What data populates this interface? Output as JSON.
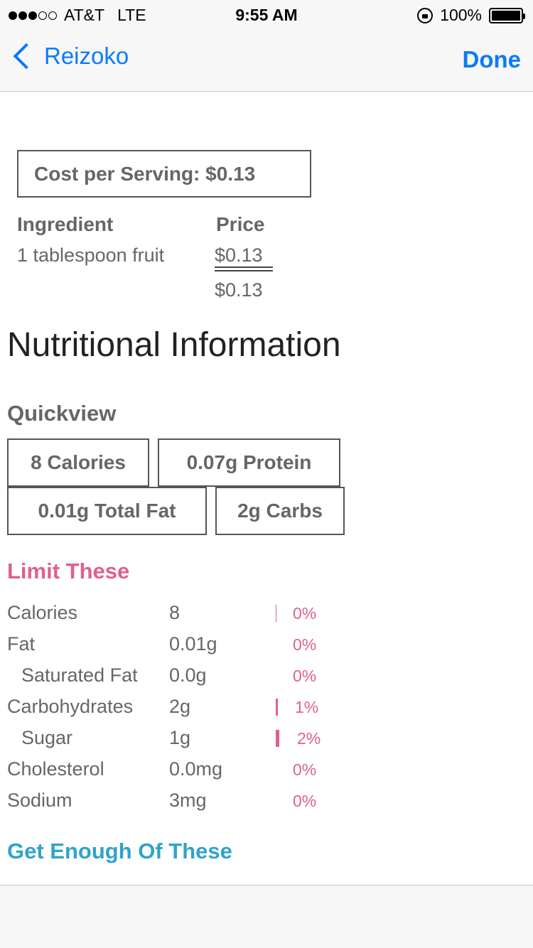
{
  "status_bar": {
    "carrier": "AT&T",
    "network": "LTE",
    "time": "9:55 AM",
    "battery_text": "100%",
    "signal_bars_filled": 3,
    "signal_bars_total": 5
  },
  "nav": {
    "back_label": "Reizoko",
    "done_label": "Done"
  },
  "cost": {
    "summary": "Cost per Serving: $0.13",
    "ingredient_header": "Ingredient",
    "price_header": "Price",
    "rows": [
      {
        "ingredient": "1 tablespoon fruit",
        "price": "$0.13"
      }
    ],
    "total": "$0.13"
  },
  "nutrition": {
    "title": "Nutritional Information",
    "quickview_title": "Quickview",
    "quickview": [
      "8 Calories",
      "0.07g Protein",
      "0.01g Total Fat",
      "2g Carbs"
    ],
    "limit_title": "Limit These",
    "limit_rows": [
      {
        "label": "Calories",
        "value": "8",
        "percent": "0%",
        "percent_value": 0
      },
      {
        "label": "Fat",
        "value": "0.01g",
        "percent": "0%",
        "percent_value": 0
      },
      {
        "label": "Saturated Fat",
        "value": "0.0g",
        "percent": "0%",
        "percent_value": 0
      },
      {
        "label": "Carbohydrates",
        "value": "2g",
        "percent": "1%",
        "percent_value": 1
      },
      {
        "label": "Sugar",
        "value": "1g",
        "percent": "2%",
        "percent_value": 2
      },
      {
        "label": "Cholesterol",
        "value": "0.0mg",
        "percent": "0%",
        "percent_value": 0
      },
      {
        "label": "Sodium",
        "value": "3mg",
        "percent": "0%",
        "percent_value": 0
      }
    ],
    "enough_title": "Get Enough Of These"
  },
  "colors": {
    "tint": "#0a7aff",
    "limit_accent": "#e0608a",
    "enough_accent": "#2fa3cc"
  }
}
